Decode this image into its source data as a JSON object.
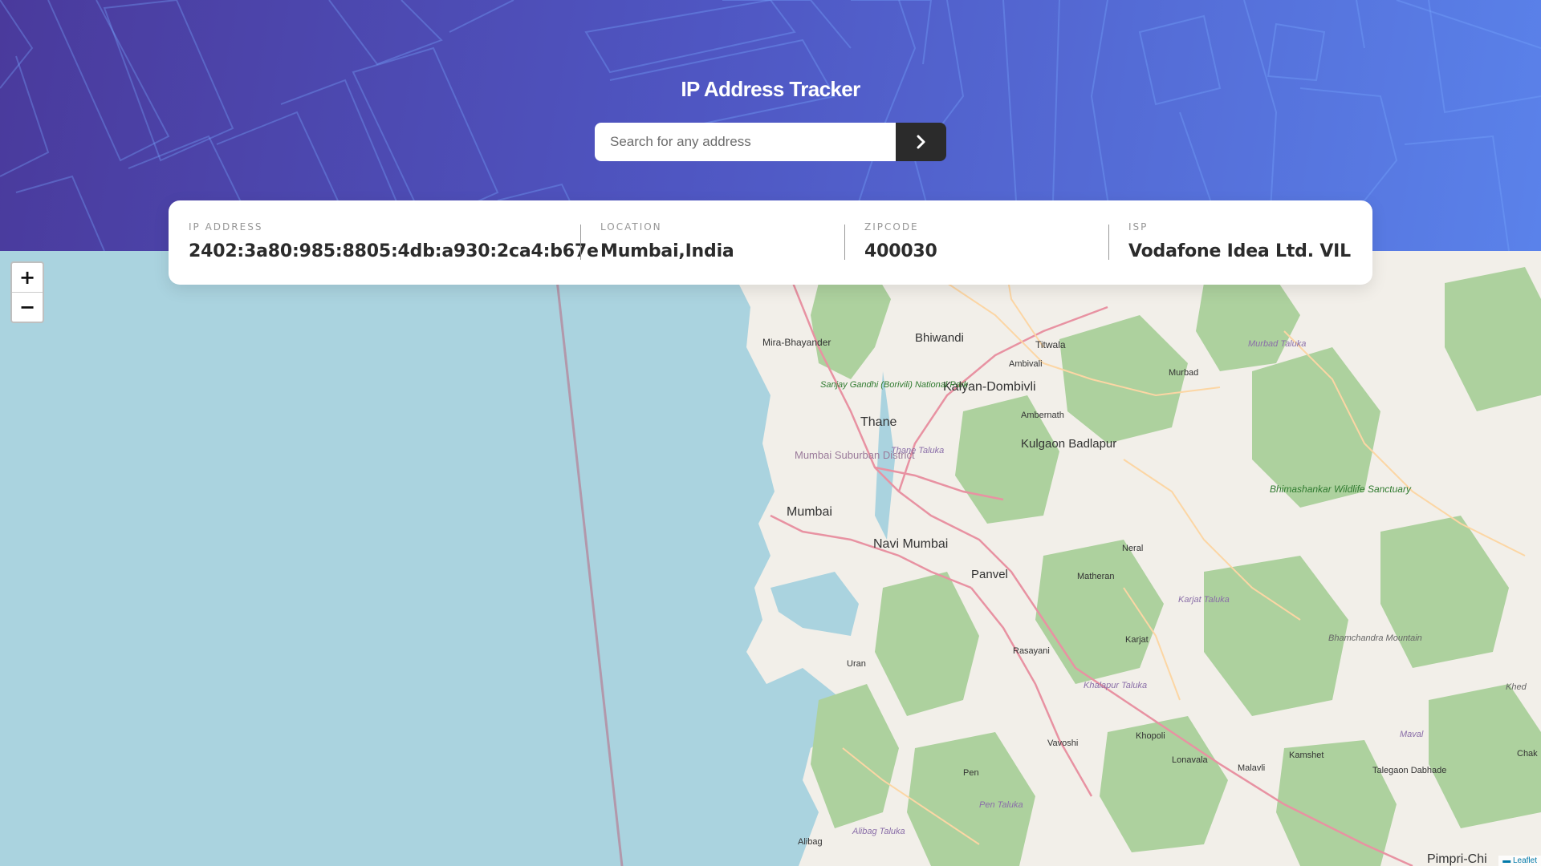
{
  "app": {
    "title": "IP Address Tracker"
  },
  "search": {
    "placeholder": "Search for any address",
    "value": ""
  },
  "info": {
    "ip": {
      "label": "IP ADDRESS",
      "value": "2402:3a80:985:8805:4db:a930:2ca4:b67e"
    },
    "location": {
      "label": "LOCATION",
      "value": "Mumbai,India"
    },
    "zipcode": {
      "label": "ZIPCODE",
      "value": "400030"
    },
    "isp": {
      "label": "ISP",
      "value": "Vodafone Idea Ltd. VIL"
    }
  },
  "map": {
    "zoom_in": "+",
    "zoom_out": "−",
    "attribution": "Leaflet",
    "places": {
      "bhiwandi": "Bhiwandi",
      "mira": "Mira-Bhayander",
      "titwala": "Titwala",
      "ambivali": "Ambivali",
      "kalyan": "Kalyan-Dombivli",
      "murbad": "Murbad",
      "murbad_taluka": "Murbad Taluka",
      "sanjay": "Sanjay Gandhi (Borivili) National Park",
      "thane": "Thane",
      "thane_taluka": "Thane Taluka",
      "ambernath": "Ambernath",
      "kulgaon": "Kulgaon Badlapur",
      "mumbai_suburban": "Mumbai Suburban District",
      "mumbai": "Mumbai",
      "navi_mumbai": "Navi Mumbai",
      "bhimashankar": "Bhimashankar Wildlife Sanctuary",
      "neral": "Neral",
      "panvel": "Panvel",
      "matheran": "Matheran",
      "karjat_taluka": "Karjat Taluka",
      "karjat": "Karjat",
      "rasayani": "Rasayani",
      "uran": "Uran",
      "bhamchandra": "Bhamchandra Mountain",
      "khalapur": "Khalapur Taluka",
      "khed": "Khed",
      "khopoli": "Khopoli",
      "vavoshi": "Vavoshi",
      "maval": "Maval",
      "kamshet": "Kamshet",
      "lonavala": "Lonavala",
      "malavli": "Malavli",
      "talegaon": "Talegaon Dabhade",
      "pen": "Pen",
      "pen_taluka": "Pen Taluka",
      "alibag": "Alibag",
      "alibag_taluka": "Alibag Taluka",
      "pimpri": "Pimpri-Chi",
      "chak": "Chak"
    }
  }
}
